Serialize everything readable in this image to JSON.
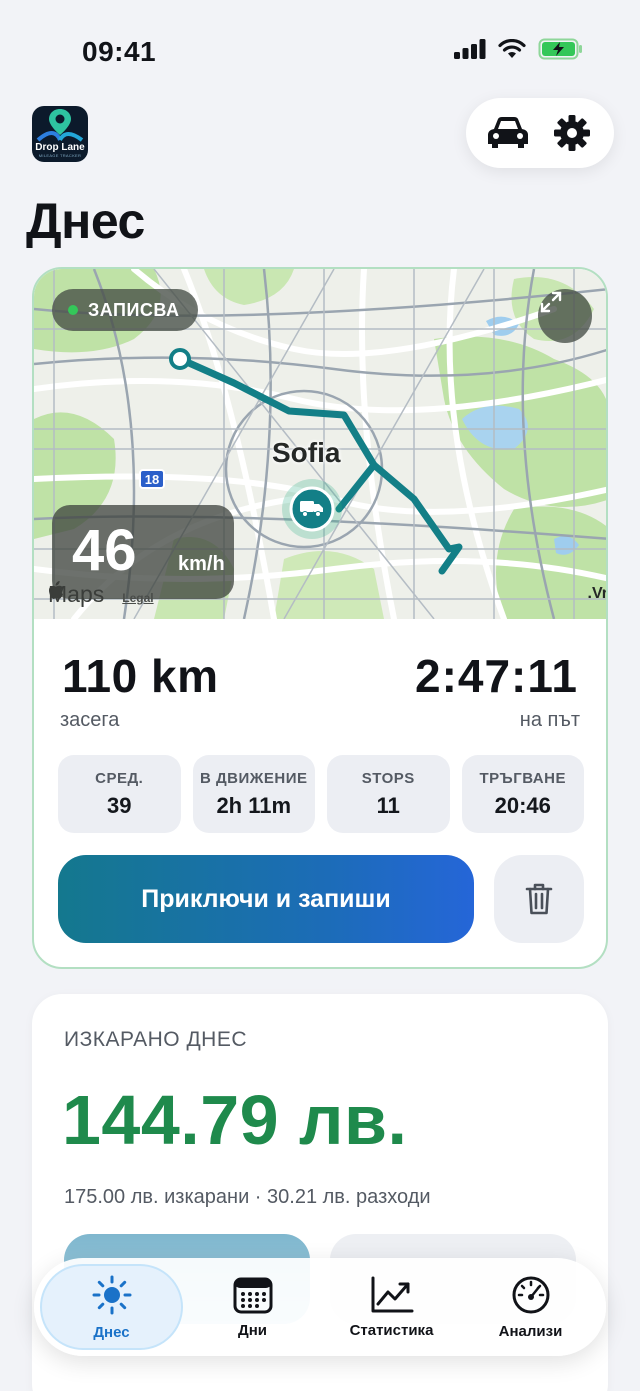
{
  "status_bar": {
    "time": "09:41"
  },
  "header": {
    "logo_text": "Drop Lane",
    "logo_subtext": "MILEAGE TRACKER",
    "title": "Днес",
    "icons": {
      "vehicle": "car-icon",
      "settings": "gear-icon"
    }
  },
  "trip": {
    "recording_label": "ЗАПИСВА",
    "map": {
      "city_label": "Sofia",
      "road_shield": "18",
      "edge_label": ".Vr",
      "maps_brand": "Maps",
      "legal": "Legal"
    },
    "speed": {
      "value": "46",
      "unit": "km/h"
    },
    "distance": {
      "value": "110 km",
      "label": "засега"
    },
    "duration": {
      "value": "2:47:11",
      "label": "на път"
    },
    "stats": [
      {
        "label": "СРЕД.",
        "value": "39"
      },
      {
        "label": "В ДВИЖЕНИЕ",
        "value": "2h 11m"
      },
      {
        "label": "STOPS",
        "value": "11"
      },
      {
        "label": "ТРЪГВАНЕ",
        "value": "20:46"
      }
    ],
    "finish_label": "Приключи и запиши"
  },
  "earnings": {
    "label": "ИЗКАРАНО ДНЕС",
    "amount": "144.79 лв.",
    "breakdown": "175.00 лв. изкарани · 30.21 лв. разходи"
  },
  "tabs": [
    {
      "label": "Днес",
      "icon": "sun-icon",
      "active": true
    },
    {
      "label": "Дни",
      "icon": "calendar-icon",
      "active": false
    },
    {
      "label": "Статистика",
      "icon": "chart-icon",
      "active": false
    },
    {
      "label": "Анализи",
      "icon": "speedometer-icon",
      "active": false
    }
  ],
  "colors": {
    "accent": "#1a72c8",
    "earnings_green": "#1f8a4c",
    "route_teal": "#137f87",
    "recording_dot": "#34c759"
  }
}
